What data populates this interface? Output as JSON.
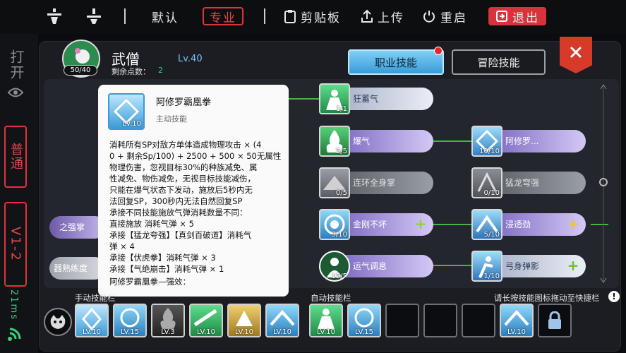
{
  "topbar": {
    "btn_default": "默认",
    "btn_pro": "专业",
    "btn_clipboard": "剪贴板",
    "btn_upload": "上传",
    "btn_restart": "重启",
    "btn_exit": "退出"
  },
  "sidebar": {
    "open": "打开",
    "mode": "普通",
    "version": "V1-2",
    "ping": "21ms"
  },
  "character": {
    "name": "武僧",
    "level": "Lv.40",
    "avatar_level": "50/40",
    "points_label": "剩余点数：",
    "points_value": "2"
  },
  "tabs": {
    "job": "职业技能",
    "adventure": "冒险技能"
  },
  "skills": {
    "kuangxuqi": {
      "name": "狂蓄气",
      "level": "1/1"
    },
    "baoqi": {
      "name": "爆气",
      "level": "5/5"
    },
    "axiuluo": {
      "name": "阿修罗...",
      "level": "10/10"
    },
    "lianhuan": {
      "name": "连环全身掌",
      "level": "0/5"
    },
    "menglong": {
      "name": "猛龙穹强",
      "level": "0/10"
    },
    "jingang": {
      "name": "金刚不坏",
      "level": "3/10"
    },
    "jintoujin": {
      "name": "浸透劲",
      "level": "5/10"
    },
    "yunqi": {
      "name": "运气调息",
      "level": "15/5"
    },
    "gongshen": {
      "name": "弓身弹影",
      "level": "1/10"
    },
    "partial1": "之强掌",
    "partial2": "器熟练度"
  },
  "tooltip": {
    "title": "阿修罗霸凰拳",
    "type": "主动技能",
    "icon_level": "Lv.10",
    "lines": [
      "消耗所有SP对敌方单体造成物理攻击 × (4",
      "0 + 剩余Sp/100) + 2500 + 500 × 50无属性",
      "物理伤害，忽视目标30%的种族减免、属",
      "性减免、物伤减免，无视目标技能减伤，",
      "只能在爆气状态下发动，施放后5秒内无",
      "法回复SP，300秒内无法自然回复SP",
      "承接不同技能施放气弹消耗数量不同：",
      "直接施放 消耗气弹 × 5",
      "承接【猛龙夸强】【真剑百破道】消耗气",
      "弹 × 4",
      "承接【伏虎拳】消耗气弹 × 3",
      "承接【气绝崩击】消耗气弹 × 1",
      "",
      "阿修罗霸凰拳—强效："
    ]
  },
  "bottom": {
    "manual_label": "手动技能栏",
    "auto_label": "自动技能栏",
    "hint": "请长按技能图标拖动至快捷栏",
    "manual_slots": [
      "LV.10",
      "LV.15",
      "LV.3",
      "LV.10",
      "LV.10",
      "LV.10"
    ],
    "auto_slots": [
      "LV.10",
      "LV.15"
    ],
    "extra_slot": "LV.10"
  }
}
